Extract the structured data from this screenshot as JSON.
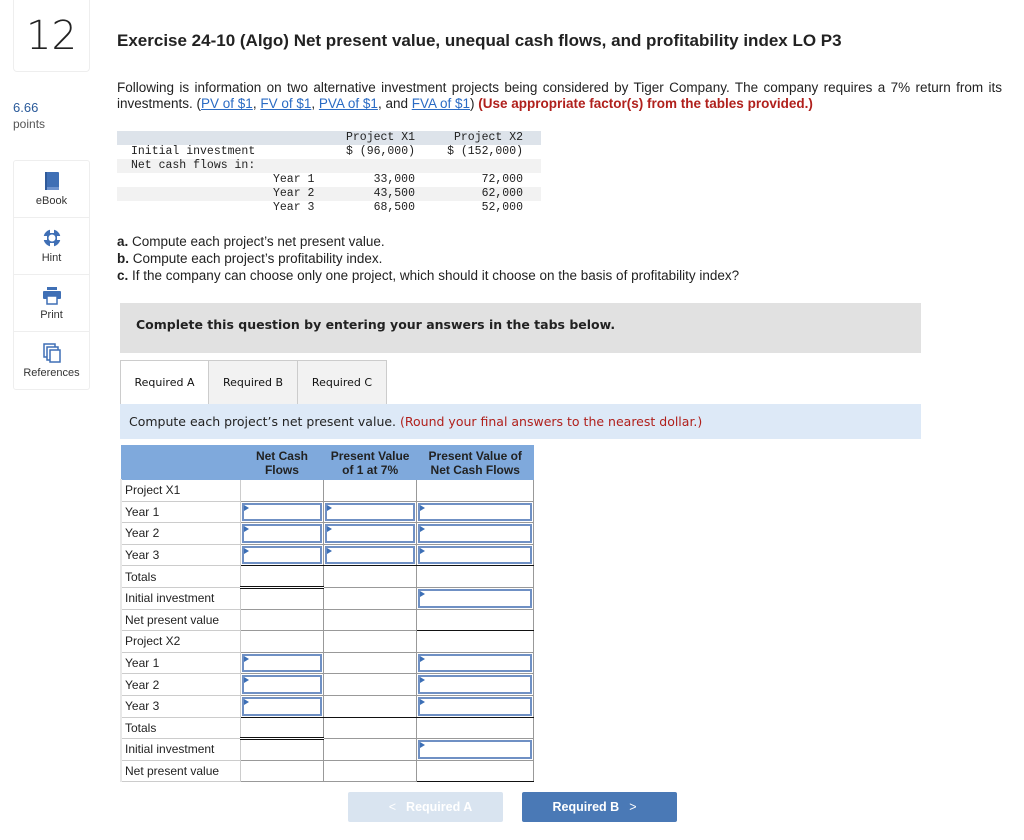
{
  "question": {
    "number": "12",
    "points_value": "6.66",
    "points_label": "points"
  },
  "tools": [
    {
      "icon": "book-icon",
      "label": "eBook"
    },
    {
      "icon": "lifebuoy-icon",
      "label": "Hint"
    },
    {
      "icon": "printer-icon",
      "label": "Print"
    },
    {
      "icon": "documents-icon",
      "label": "References"
    }
  ],
  "title": "Exercise 24-10 (Algo) Net present value, unequal cash flows, and profitability index LO P3",
  "intro": {
    "text1": "Following is information on two alternative investment projects being considered by Tiger Company. The company requires a 7% return from its investments. (",
    "links": [
      "PV of $1",
      "FV of $1",
      "PVA of $1",
      "FVA of $1"
    ],
    "sep1": ", ",
    "sep2": ", ",
    "sep3": ", and ",
    "close": ") ",
    "instruction": "(Use appropriate factor(s) from the tables provided.)"
  },
  "given_table": {
    "headers": [
      "",
      "",
      "Project X1",
      "Project X2"
    ],
    "rows": [
      {
        "label": "Initial investment",
        "sub": "",
        "x1": "$ (96,000)",
        "x2": "$ (152,000)"
      },
      {
        "label": "Net cash flows in:",
        "sub": "",
        "x1": "",
        "x2": ""
      },
      {
        "label": "",
        "sub": "Year 1",
        "x1": "33,000",
        "x2": "72,000"
      },
      {
        "label": "",
        "sub": "Year 2",
        "x1": "43,500",
        "x2": "62,000"
      },
      {
        "label": "",
        "sub": "Year 3",
        "x1": "68,500",
        "x2": "52,000"
      }
    ]
  },
  "requirements": [
    {
      "letter": "a.",
      "text": " Compute each project’s net present value."
    },
    {
      "letter": "b.",
      "text": " Compute each project’s profitability index."
    },
    {
      "letter": "c.",
      "text": " If the company can choose only one project, which should it choose on the basis of profitability index?"
    }
  ],
  "banner": "Complete this question by entering your answers in the tabs below.",
  "tabs": [
    {
      "label": "Required A",
      "active": true
    },
    {
      "label": "Required B",
      "active": false
    },
    {
      "label": "Required C",
      "active": false
    }
  ],
  "instruction": {
    "text": "Compute each project’s net present value. ",
    "note": "(Round your final answers to the nearest dollar.)"
  },
  "answer_table": {
    "headers": [
      "",
      "Net Cash Flows",
      "Present Value of 1 at 7%",
      "Present Value of Net Cash Flows"
    ],
    "rows": [
      {
        "label": "Project X1",
        "inputs": [
          false,
          false,
          false
        ]
      },
      {
        "label": "Year 1",
        "inputs": [
          true,
          true,
          true
        ],
        "values": [
          "",
          "",
          ""
        ]
      },
      {
        "label": "Year 2",
        "inputs": [
          true,
          true,
          true
        ],
        "values": [
          "",
          "",
          ""
        ]
      },
      {
        "label": "Year 3",
        "inputs": [
          true,
          true,
          true
        ],
        "values": [
          "",
          "",
          ""
        ]
      },
      {
        "label": "Totals",
        "inputs": [
          false,
          false,
          false
        ]
      },
      {
        "label": "Initial investment",
        "inputs": [
          false,
          false,
          true
        ],
        "values": [
          "",
          "",
          ""
        ]
      },
      {
        "label": "Net present value",
        "inputs": [
          false,
          false,
          false
        ]
      },
      {
        "label": "Project X2",
        "inputs": [
          false,
          false,
          false
        ]
      },
      {
        "label": "Year 1",
        "inputs": [
          true,
          false,
          true
        ],
        "values": [
          "",
          "",
          ""
        ]
      },
      {
        "label": "Year 2",
        "inputs": [
          true,
          false,
          true
        ],
        "values": [
          "",
          "",
          ""
        ]
      },
      {
        "label": "Year 3",
        "inputs": [
          true,
          false,
          true
        ],
        "values": [
          "",
          "",
          ""
        ]
      },
      {
        "label": "Totals",
        "inputs": [
          false,
          false,
          false
        ]
      },
      {
        "label": "Initial investment",
        "inputs": [
          false,
          false,
          true
        ],
        "values": [
          "",
          "",
          ""
        ]
      },
      {
        "label": "Net present value",
        "inputs": [
          false,
          false,
          false
        ]
      }
    ]
  },
  "nav": {
    "prev_label": "Required A",
    "next_label": "Required B",
    "prev_icon": "chevron-left-icon",
    "next_icon": "chevron-right-icon"
  },
  "colors": {
    "link": "#2a6bc4",
    "alert_red": "#b0201c",
    "table_header": "#7fa9dc",
    "primary_button": "#4a79b6",
    "disabled_button": "#d9e4f0",
    "instruction_bg": "#dde9f7"
  }
}
